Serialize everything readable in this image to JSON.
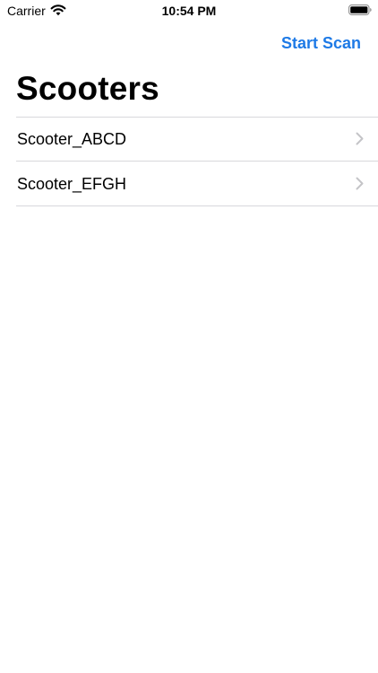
{
  "status_bar": {
    "carrier": "Carrier",
    "time": "10:54 PM",
    "icons": [
      "wifi-icon",
      "battery-icon"
    ]
  },
  "nav": {
    "action_label": "Start Scan",
    "title": "Scooters"
  },
  "list": {
    "items": [
      {
        "label": "Scooter_ABCD",
        "icon": "chevron-right-icon"
      },
      {
        "label": "Scooter_EFGH",
        "icon": "chevron-right-icon"
      }
    ]
  },
  "colors": {
    "accent": "#1e7ae6",
    "separator": "#d8d8dc",
    "chevron": "#c4c4c7"
  }
}
